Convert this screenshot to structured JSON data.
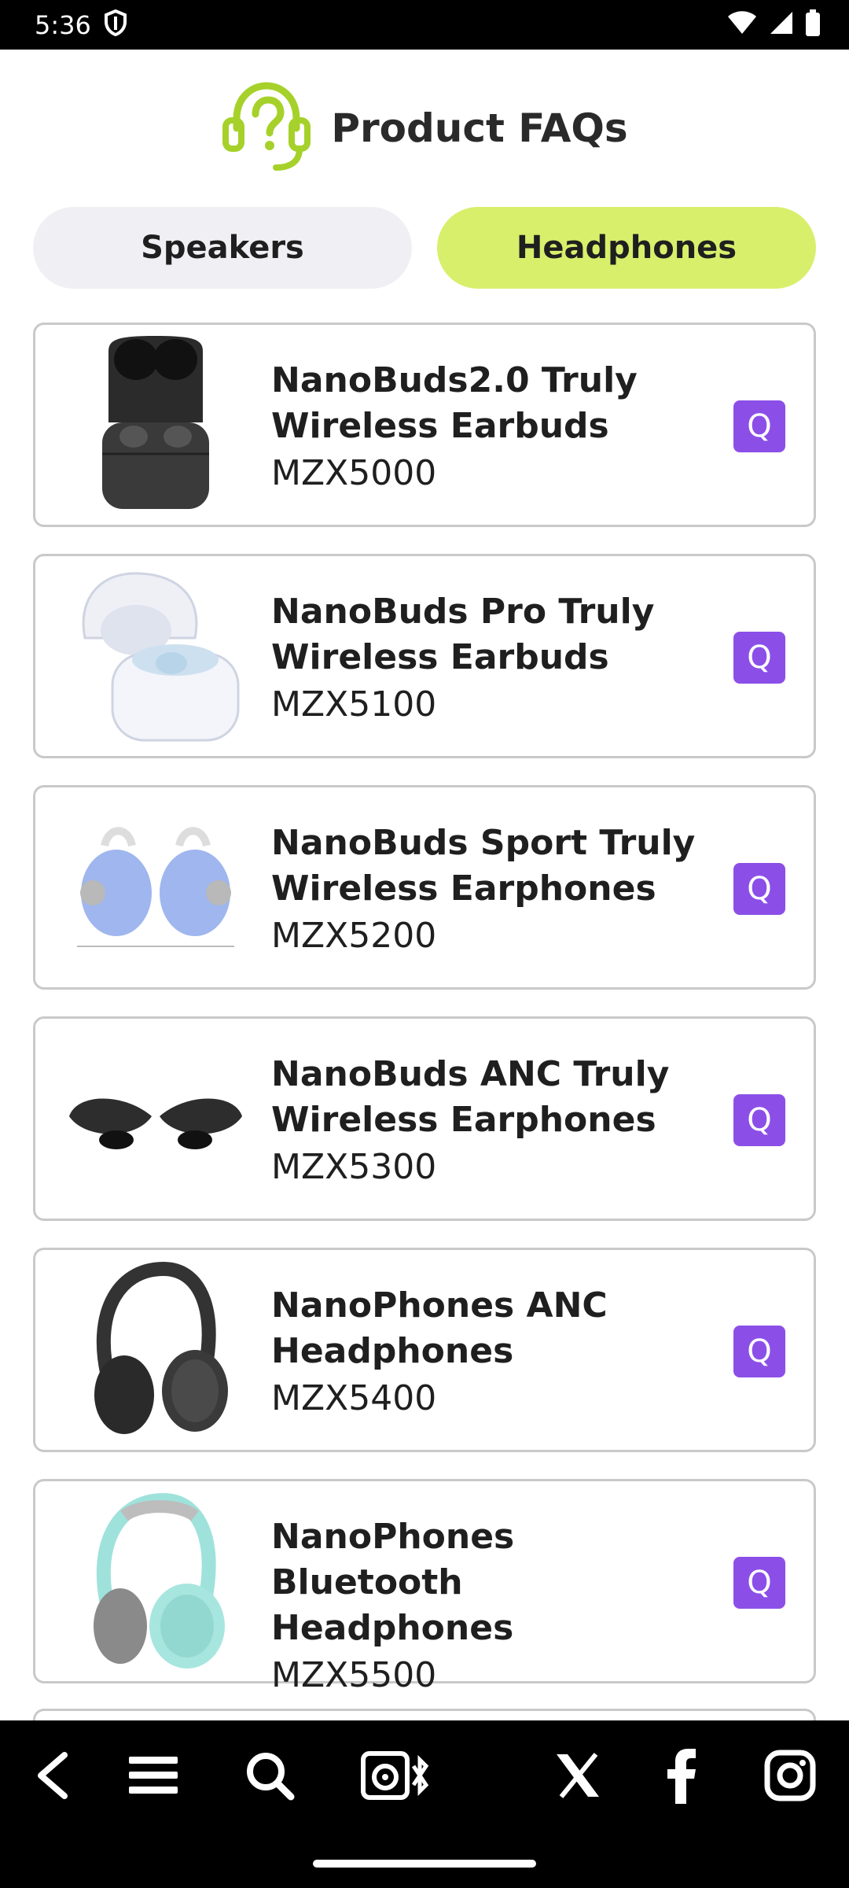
{
  "status_bar": {
    "time": "5:36"
  },
  "header": {
    "title": "Product FAQs",
    "icon": "headset-question-icon"
  },
  "tabs": [
    {
      "label": "Speakers",
      "active": false
    },
    {
      "label": "Headphones",
      "active": true
    }
  ],
  "products": [
    {
      "name": "NanoBuds2.0 Truly Wireless Earbuds",
      "model": "MZX5000",
      "button": "Q"
    },
    {
      "name": "NanoBuds Pro Truly Wireless Earbuds",
      "model": "MZX5100",
      "button": "Q"
    },
    {
      "name": "NanoBuds Sport Truly Wireless Earphones",
      "model": "MZX5200",
      "button": "Q"
    },
    {
      "name": "NanoBuds ANC Truly Wireless Earphones",
      "model": "MZX5300",
      "button": "Q"
    },
    {
      "name": "NanoPhones ANC Headphones",
      "model": "MZX5400",
      "button": "Q"
    },
    {
      "name": "NanoPhones Bluetooth Headphones",
      "model": "MZX5500",
      "button": "Q"
    }
  ],
  "toolbar": {
    "icons": [
      "back-icon",
      "menu-icon",
      "search-icon",
      "speaker-bluetooth-icon",
      "x-icon",
      "facebook-icon",
      "instagram-icon"
    ]
  },
  "colors": {
    "accent_green": "#d8ef6c",
    "icon_green": "#a6d12a",
    "q_purple": "#8b4fe8",
    "inactive_tab": "#f0f0f4"
  }
}
